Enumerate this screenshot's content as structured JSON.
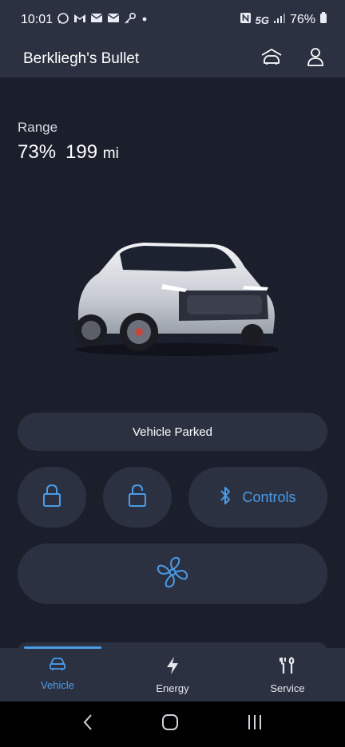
{
  "status_bar": {
    "time": "10:01",
    "network": "5G",
    "battery": "76%",
    "left_icons": [
      "whatsapp-icon",
      "gmail-icon",
      "mail-icon",
      "mail-icon",
      "key-icon",
      "dot-icon"
    ],
    "right_icons": [
      "nfc-icon",
      "signal-icon",
      "battery-icon"
    ]
  },
  "app_bar": {
    "title": "Berkliegh's Bullet",
    "icons": [
      "garage-icon",
      "account-icon"
    ]
  },
  "range": {
    "label": "Range",
    "percent": "73%",
    "distance": "199",
    "unit": "mi"
  },
  "vehicle": {
    "status": "Vehicle Parked",
    "image_icon": "car-image"
  },
  "controls": {
    "lock_icon": "lock-icon",
    "unlock_icon": "unlock-icon",
    "controls_label": "Controls",
    "bluetooth_icon": "bluetooth-icon",
    "fan_icon": "fan-icon"
  },
  "tabs": [
    {
      "label": "Vehicle",
      "icon": "car-icon",
      "active": true
    },
    {
      "label": "Energy",
      "icon": "bolt-icon",
      "active": false
    },
    {
      "label": "Service",
      "icon": "wrench-icon",
      "active": false
    }
  ],
  "colors": {
    "background": "#1b1f2c",
    "surface": "#2c3142",
    "accent": "#4a9ce8",
    "text": "#ffffff"
  }
}
